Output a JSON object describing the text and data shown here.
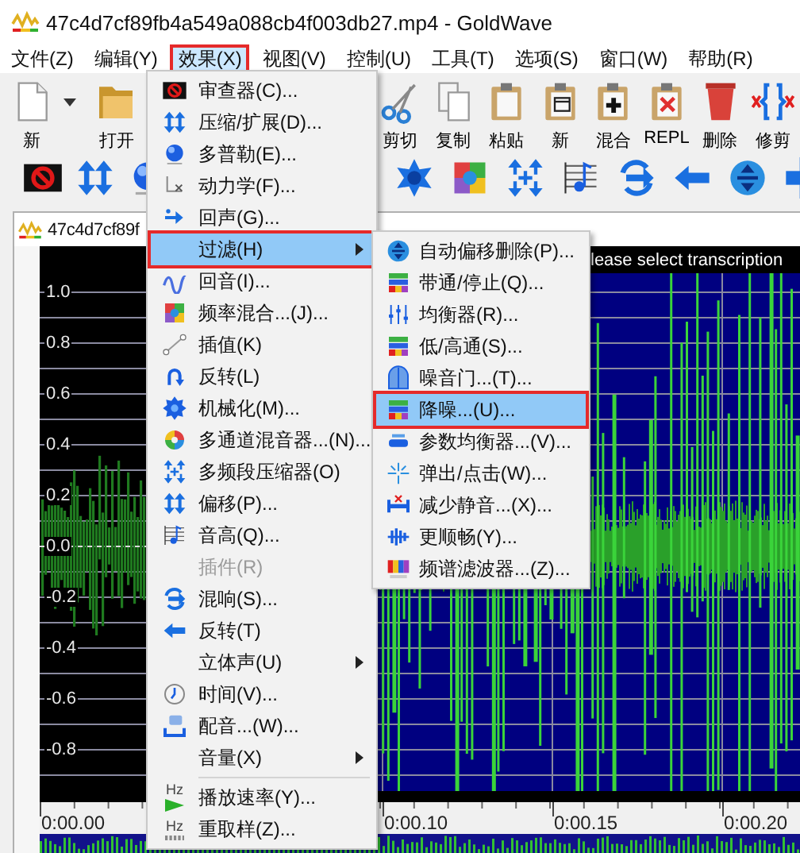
{
  "window": {
    "title": "47c4d7cf89fb4a549a088cb4f003db27.mp4 - GoldWave"
  },
  "menubar": [
    {
      "label": "文件(Z)",
      "selected": false,
      "marked": false
    },
    {
      "label": "编辑(Y)",
      "selected": false,
      "marked": false
    },
    {
      "label": "效果(X)",
      "selected": true,
      "marked": true
    },
    {
      "label": "视图(V)",
      "selected": false,
      "marked": false
    },
    {
      "label": "控制(U)",
      "selected": false,
      "marked": false
    },
    {
      "label": "工具(T)",
      "selected": false,
      "marked": false
    },
    {
      "label": "选项(S)",
      "selected": false,
      "marked": false
    },
    {
      "label": "窗口(W)",
      "selected": false,
      "marked": false
    },
    {
      "label": "帮助(R)",
      "selected": false,
      "marked": false
    }
  ],
  "toolbar": [
    {
      "label": "新",
      "dropdown": true
    },
    {
      "label": "打开",
      "dropdown": false
    },
    {
      "label": "剪切",
      "dropdown": false
    },
    {
      "label": "复制",
      "dropdown": false
    },
    {
      "label": "粘贴",
      "dropdown": false
    },
    {
      "label": "新",
      "dropdown": false
    },
    {
      "label": "混合",
      "dropdown": false
    },
    {
      "label": "REPL",
      "dropdown": false
    },
    {
      "label": "删除",
      "dropdown": false
    },
    {
      "label": "修剪",
      "dropdown": false
    }
  ],
  "document": {
    "title": "47c4d7cf89f",
    "header_text": "lease select transcription",
    "amplitude_labels": [
      "1.0",
      "0.8",
      "0.6",
      "0.4",
      "0.2",
      "0.0",
      "-0.2",
      "-0.4",
      "-0.6",
      "-0.8"
    ],
    "time_labels": [
      "0:00.00",
      "0:00.10",
      "0:00.15",
      "0:00.20"
    ]
  },
  "effects_menu": {
    "items": [
      {
        "kind": "item",
        "label": "审查器(C)...",
        "selected": false,
        "disabled": false,
        "submenu": false,
        "marked": false
      },
      {
        "kind": "item",
        "label": "压缩/扩展(D)...",
        "selected": false,
        "disabled": false,
        "submenu": false,
        "marked": false
      },
      {
        "kind": "item",
        "label": "多普勒(E)...",
        "selected": false,
        "disabled": false,
        "submenu": false,
        "marked": false
      },
      {
        "kind": "item",
        "label": "动力学(F)...",
        "selected": false,
        "disabled": false,
        "submenu": false,
        "marked": false
      },
      {
        "kind": "item",
        "label": "回声(G)...",
        "selected": false,
        "disabled": false,
        "submenu": false,
        "marked": false
      },
      {
        "kind": "item",
        "label": "过滤(H)",
        "selected": true,
        "disabled": false,
        "submenu": true,
        "marked": true
      },
      {
        "kind": "item",
        "label": "回音(I)...",
        "selected": false,
        "disabled": false,
        "submenu": false,
        "marked": false
      },
      {
        "kind": "item",
        "label": "频率混合...(J)...",
        "selected": false,
        "disabled": false,
        "submenu": false,
        "marked": false
      },
      {
        "kind": "item",
        "label": "插值(K)",
        "selected": false,
        "disabled": false,
        "submenu": false,
        "marked": false
      },
      {
        "kind": "item",
        "label": "反转(L)",
        "selected": false,
        "disabled": false,
        "submenu": false,
        "marked": false
      },
      {
        "kind": "item",
        "label": "机械化(M)...",
        "selected": false,
        "disabled": false,
        "submenu": false,
        "marked": false
      },
      {
        "kind": "item",
        "label": "多通道混音器...(N)...",
        "selected": false,
        "disabled": false,
        "submenu": false,
        "marked": false
      },
      {
        "kind": "item",
        "label": "多频段压缩器(O)",
        "selected": false,
        "disabled": false,
        "submenu": false,
        "marked": false
      },
      {
        "kind": "item",
        "label": "偏移(P)...",
        "selected": false,
        "disabled": false,
        "submenu": false,
        "marked": false
      },
      {
        "kind": "item",
        "label": "音高(Q)...",
        "selected": false,
        "disabled": false,
        "submenu": false,
        "marked": false
      },
      {
        "kind": "item",
        "label": "插件(R)",
        "selected": false,
        "disabled": true,
        "submenu": false,
        "marked": false
      },
      {
        "kind": "item",
        "label": "混响(S)...",
        "selected": false,
        "disabled": false,
        "submenu": false,
        "marked": false
      },
      {
        "kind": "item",
        "label": "反转(T)",
        "selected": false,
        "disabled": false,
        "submenu": false,
        "marked": false
      },
      {
        "kind": "item",
        "label": "立体声(U)",
        "selected": false,
        "disabled": false,
        "submenu": true,
        "marked": false
      },
      {
        "kind": "item",
        "label": "时间(V)...",
        "selected": false,
        "disabled": false,
        "submenu": false,
        "marked": false
      },
      {
        "kind": "item",
        "label": "配音...(W)...",
        "selected": false,
        "disabled": false,
        "submenu": false,
        "marked": false
      },
      {
        "kind": "item",
        "label": "音量(X)",
        "selected": false,
        "disabled": false,
        "submenu": true,
        "marked": false
      },
      {
        "kind": "separator"
      },
      {
        "kind": "item",
        "label": "播放速率(Y)...",
        "icon_text": "Hz",
        "selected": false,
        "disabled": false,
        "submenu": false,
        "marked": false
      },
      {
        "kind": "item",
        "label": "重取样(Z)...",
        "icon_text": "Hz",
        "selected": false,
        "disabled": false,
        "submenu": false,
        "marked": false
      }
    ]
  },
  "filter_submenu": {
    "items": [
      {
        "kind": "item",
        "label": "自动偏移删除(P)...",
        "selected": false,
        "disabled": false,
        "submenu": false,
        "marked": false
      },
      {
        "kind": "item",
        "label": "带通/停止(Q)...",
        "selected": false,
        "disabled": false,
        "submenu": false,
        "marked": false
      },
      {
        "kind": "item",
        "label": "均衡器(R)...",
        "selected": false,
        "disabled": false,
        "submenu": false,
        "marked": false
      },
      {
        "kind": "item",
        "label": "低/高通(S)...",
        "selected": false,
        "disabled": false,
        "submenu": false,
        "marked": false
      },
      {
        "kind": "item",
        "label": "噪音门...(T)...",
        "selected": false,
        "disabled": false,
        "submenu": false,
        "marked": false
      },
      {
        "kind": "item",
        "label": "降噪...(U)...",
        "selected": true,
        "disabled": false,
        "submenu": false,
        "marked": true
      },
      {
        "kind": "item",
        "label": "参数均衡器...(V)...",
        "selected": false,
        "disabled": false,
        "submenu": false,
        "marked": false
      },
      {
        "kind": "item",
        "label": "弹出/点击(W)...",
        "selected": false,
        "disabled": false,
        "submenu": false,
        "marked": false
      },
      {
        "kind": "item",
        "label": "减少静音...(X)...",
        "selected": false,
        "disabled": false,
        "submenu": false,
        "marked": false
      },
      {
        "kind": "item",
        "label": "更顺畅(Y)...",
        "selected": false,
        "disabled": false,
        "submenu": false,
        "marked": false
      },
      {
        "kind": "item",
        "label": "频谱滤波器...(Z)...",
        "selected": false,
        "disabled": false,
        "submenu": false,
        "marked": false
      }
    ]
  }
}
